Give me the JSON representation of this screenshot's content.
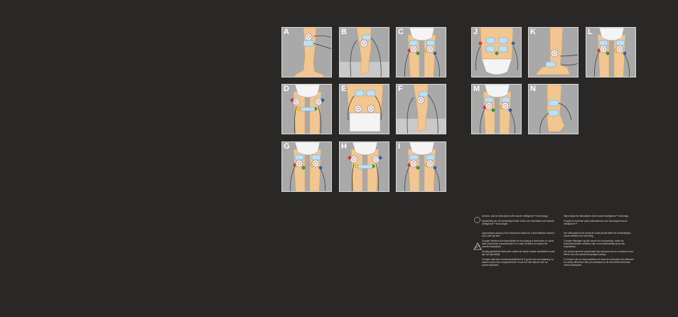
{
  "tiles": [
    {
      "letter": "A",
      "variant": "knee"
    },
    {
      "letter": "B",
      "variant": "calf"
    },
    {
      "letter": "C",
      "variant": "thighs"
    },
    {
      "letter": "D",
      "variant": "hips"
    },
    {
      "letter": "E",
      "variant": "back"
    },
    {
      "letter": "F",
      "variant": "calf"
    },
    {
      "letter": "G",
      "variant": "thighs"
    },
    {
      "letter": "H",
      "variant": "hips"
    },
    {
      "letter": "I",
      "variant": "thighs"
    },
    {
      "letter": "J",
      "variant": "abs"
    },
    {
      "letter": "K",
      "variant": "foot"
    },
    {
      "letter": "L",
      "variant": "thighs"
    },
    {
      "letter": "M",
      "variant": "thighs"
    },
    {
      "letter": "N",
      "variant": "ankle"
    }
  ],
  "notes": {
    "left": {
      "p1": "function only for stimulators with muscle intelligence™ technology",
      "p2": "Aanduiding van de  aanwezige functie enkel voor stimulators met muscle intelligence™ technologie.",
      "p3": "Approximate placing of the electrodes makes for a less effective session, but is still risk free.",
      "p4": "Compex declines all responsibility for the placing of electrodes on areas other than those recommended or in case of failure to respect the counter-indications.",
      "p5": "Slordig geplaatste elektroden maken de sessie minder doeltreffend maar zijn niet gevaarlijk.",
      "p6": "Compex wijst alle verantwoordelijkheid af in geval van een plaatsing op andere zones dan voorgeschreven of van het niet naleven van de contra-indicaties."
    },
    "right": {
      "p1": "Sign endast för stimulatorer med muscle intelligence™-teknologi.",
      "p2": "Função do  somente para estimuladores com tecnologia muscle intelligence™.",
      "p3": "Om elektroderna inte placeras exakt på rätt ställe blir behandlingen mindre effektiv men inte farlig.",
      "p4": "Compex frånsäger sig allt ansvar för en placering i andra än rekommenderade områden eller om kontraindikationerna inte respekteras.",
      "p5": "Um posicionamento aproximado dos eletrodos torna a sessão menos eficaz mas não apresenta qualquer perigo.",
      "p6": "A Compex não se responsabiliza em caso de colocação dos elétrodos em zonas diferentes das preconizadas ou de não observância das contra-indicações."
    }
  }
}
